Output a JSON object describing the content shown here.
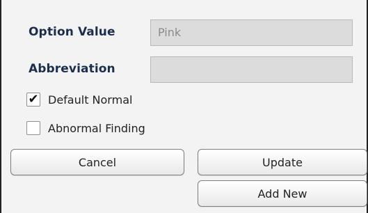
{
  "form": {
    "option_value_label": "Option Value",
    "option_value": "Pink",
    "abbreviation_label": "Abbreviation",
    "abbreviation_value": ""
  },
  "checkboxes": {
    "default_normal": {
      "label": "Default Normal",
      "checked": true,
      "mark": "✔"
    },
    "abnormal_finding": {
      "label": "Abnormal Finding",
      "checked": false,
      "mark": ""
    }
  },
  "buttons": {
    "cancel": "Cancel",
    "update": "Update",
    "add_new": "Add New"
  },
  "icons": {
    "checked": "checkmark-icon"
  },
  "colors": {
    "label_text": "#1c2e4d",
    "field_bg": "#dcdcdc",
    "panel_bg": "#f3f3f3"
  }
}
